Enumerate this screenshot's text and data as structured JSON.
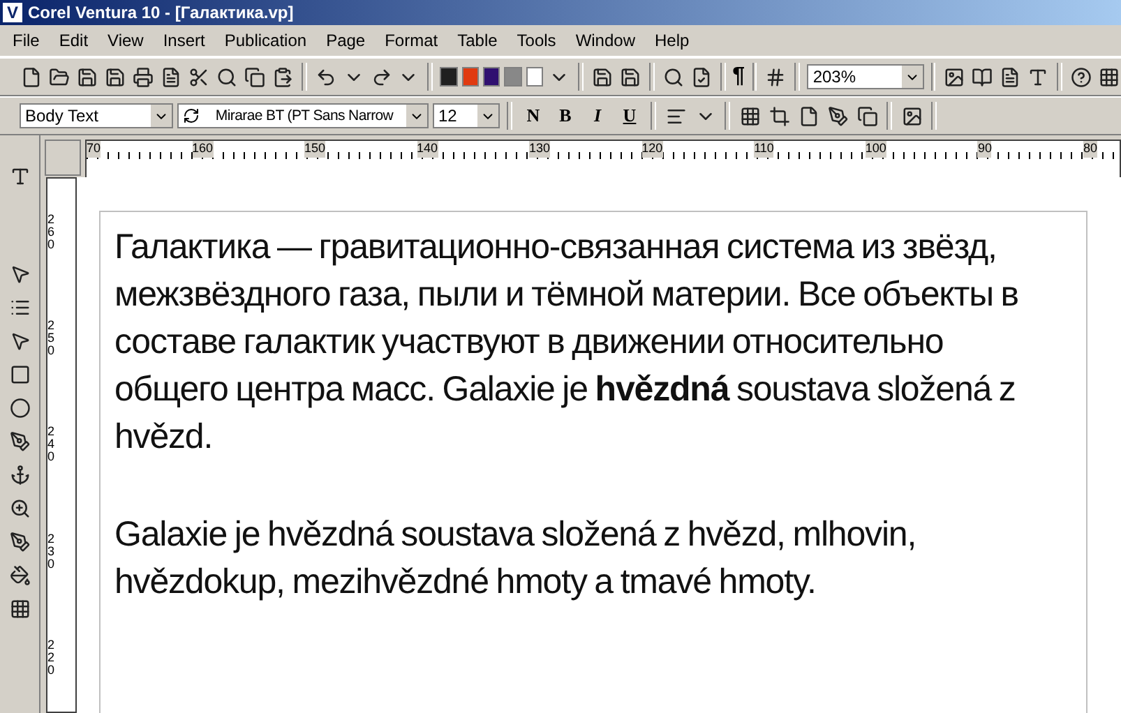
{
  "window": {
    "title": "Corel Ventura 10 - [Галактика.vp]",
    "app_icon": "V"
  },
  "menu": [
    "File",
    "Edit",
    "View",
    "Insert",
    "Publication",
    "Page",
    "Format",
    "Table",
    "Tools",
    "Window",
    "Help"
  ],
  "toolbar": {
    "swatches": [
      {
        "color": "#202020"
      },
      {
        "color": "#e03a10"
      },
      {
        "color": "#301070"
      },
      {
        "color": "#888888"
      },
      {
        "color": "#ffffff"
      }
    ],
    "pilcrow": "¶",
    "zoom": "203%"
  },
  "format_bar": {
    "style": "Body Text",
    "font": "Mirarae BT (PT Sans Narrow",
    "size": "12",
    "buttons": [
      "N",
      "B",
      "I",
      "U"
    ]
  },
  "ruler": {
    "horizontal": [
      "70",
      "160",
      "150",
      "140",
      "130",
      "120",
      "110",
      "100",
      "90",
      "80"
    ],
    "vertical": [
      "260",
      "250",
      "240",
      "230",
      "220"
    ]
  },
  "document": {
    "paragraphs": [
      "Галактика — гравитационно-связанная система из звёзд, межзвёздного газа, пыли и тёмной материи. Все объекты в составе галактик участвуют в движении относительно общего центра масс. Galaxie je **hvězdná** soustava složená z hvězd.",
      "Galaxie je hvězdná soustava složená z hvězd, mlhovin, hvězdokup, mezihvězdné hmoty a tmavé hmoty."
    ]
  }
}
